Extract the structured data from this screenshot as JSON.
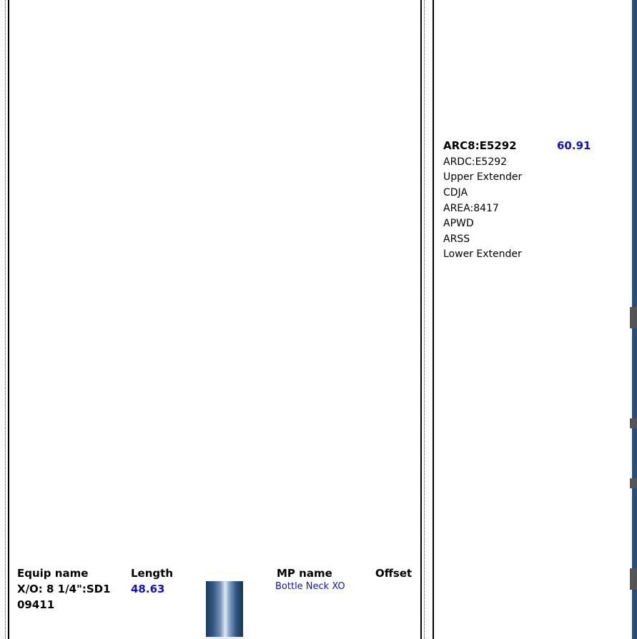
{
  "left_panel": {
    "headers": {
      "equip_name": "Equip name",
      "length": "Length",
      "mp_name": "MP name",
      "offset": "Offset"
    },
    "row": {
      "equip_name_line1": "X/O: 8 1/4\":SD1",
      "equip_name_line2": "09411",
      "length": "48.63",
      "mp_name": "Bottle Neck XO"
    }
  },
  "right_panel": {
    "title": "ARC8:E5292",
    "value": "60.91",
    "items": [
      "ARDC:E5292",
      "Upper Extender",
      "CDJA",
      "AREA:8417",
      "APWD",
      "ARSS",
      "Lower Extender"
    ]
  },
  "colors": {
    "value_blue": "#1010d0",
    "tool_dark": "#1d3a5e"
  }
}
